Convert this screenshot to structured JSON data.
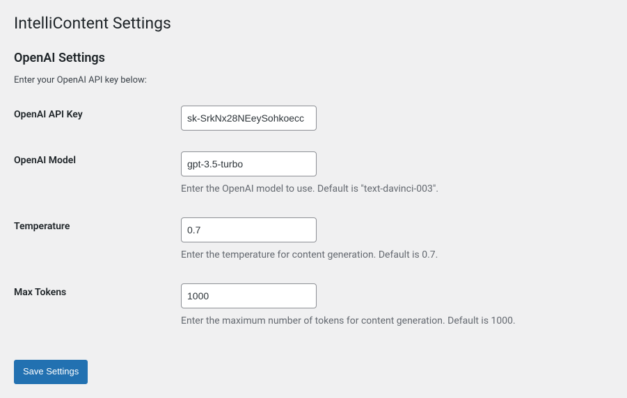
{
  "page": {
    "title": "IntelliContent Settings"
  },
  "section": {
    "heading": "OpenAI Settings",
    "intro": "Enter your OpenAI API key below:"
  },
  "fields": {
    "api_key": {
      "label": "OpenAI API Key",
      "value": "sk-SrkNx28NEeySohkoecc"
    },
    "model": {
      "label": "OpenAI Model",
      "value": "gpt-3.5-turbo",
      "description": "Enter the OpenAI model to use. Default is \"text-davinci-003\"."
    },
    "temperature": {
      "label": "Temperature",
      "value": "0.7",
      "description": "Enter the temperature for content generation. Default is 0.7."
    },
    "max_tokens": {
      "label": "Max Tokens",
      "value": "1000",
      "description": "Enter the maximum number of tokens for content generation. Default is 1000."
    }
  },
  "actions": {
    "save_label": "Save Settings"
  }
}
